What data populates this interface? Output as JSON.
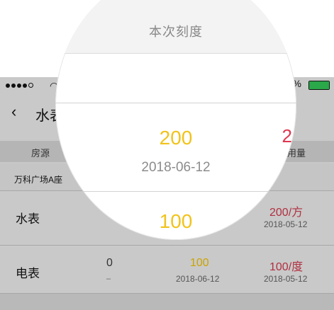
{
  "status_bar": {
    "battery_text": "100%"
  },
  "nav": {
    "back_glyph": "‹",
    "title": "水表"
  },
  "columns": {
    "room": "房源",
    "usage": "用用量"
  },
  "section_label": "万科广场A座",
  "rows": [
    {
      "name": "水表",
      "prev": "",
      "prev_date": "",
      "current": "",
      "current_date": "2018-06-12",
      "usage": "200/方",
      "usage_date": "2018-05-12"
    },
    {
      "name": "电表",
      "prev": "0",
      "prev_date": "–",
      "current": "100",
      "current_date": "2018-06-12",
      "usage": "100/度",
      "usage_date": "2018-05-12"
    }
  ],
  "magnifier": {
    "title": "本次刻度",
    "selected_value": "200",
    "selected_date": "2018-06-12",
    "next_value": "100",
    "peek_red": "2",
    "peek_gray": "2"
  },
  "colors": {
    "selected": "#f1c31b",
    "usage_red": "#b03040",
    "battery": "#2aa84a"
  }
}
